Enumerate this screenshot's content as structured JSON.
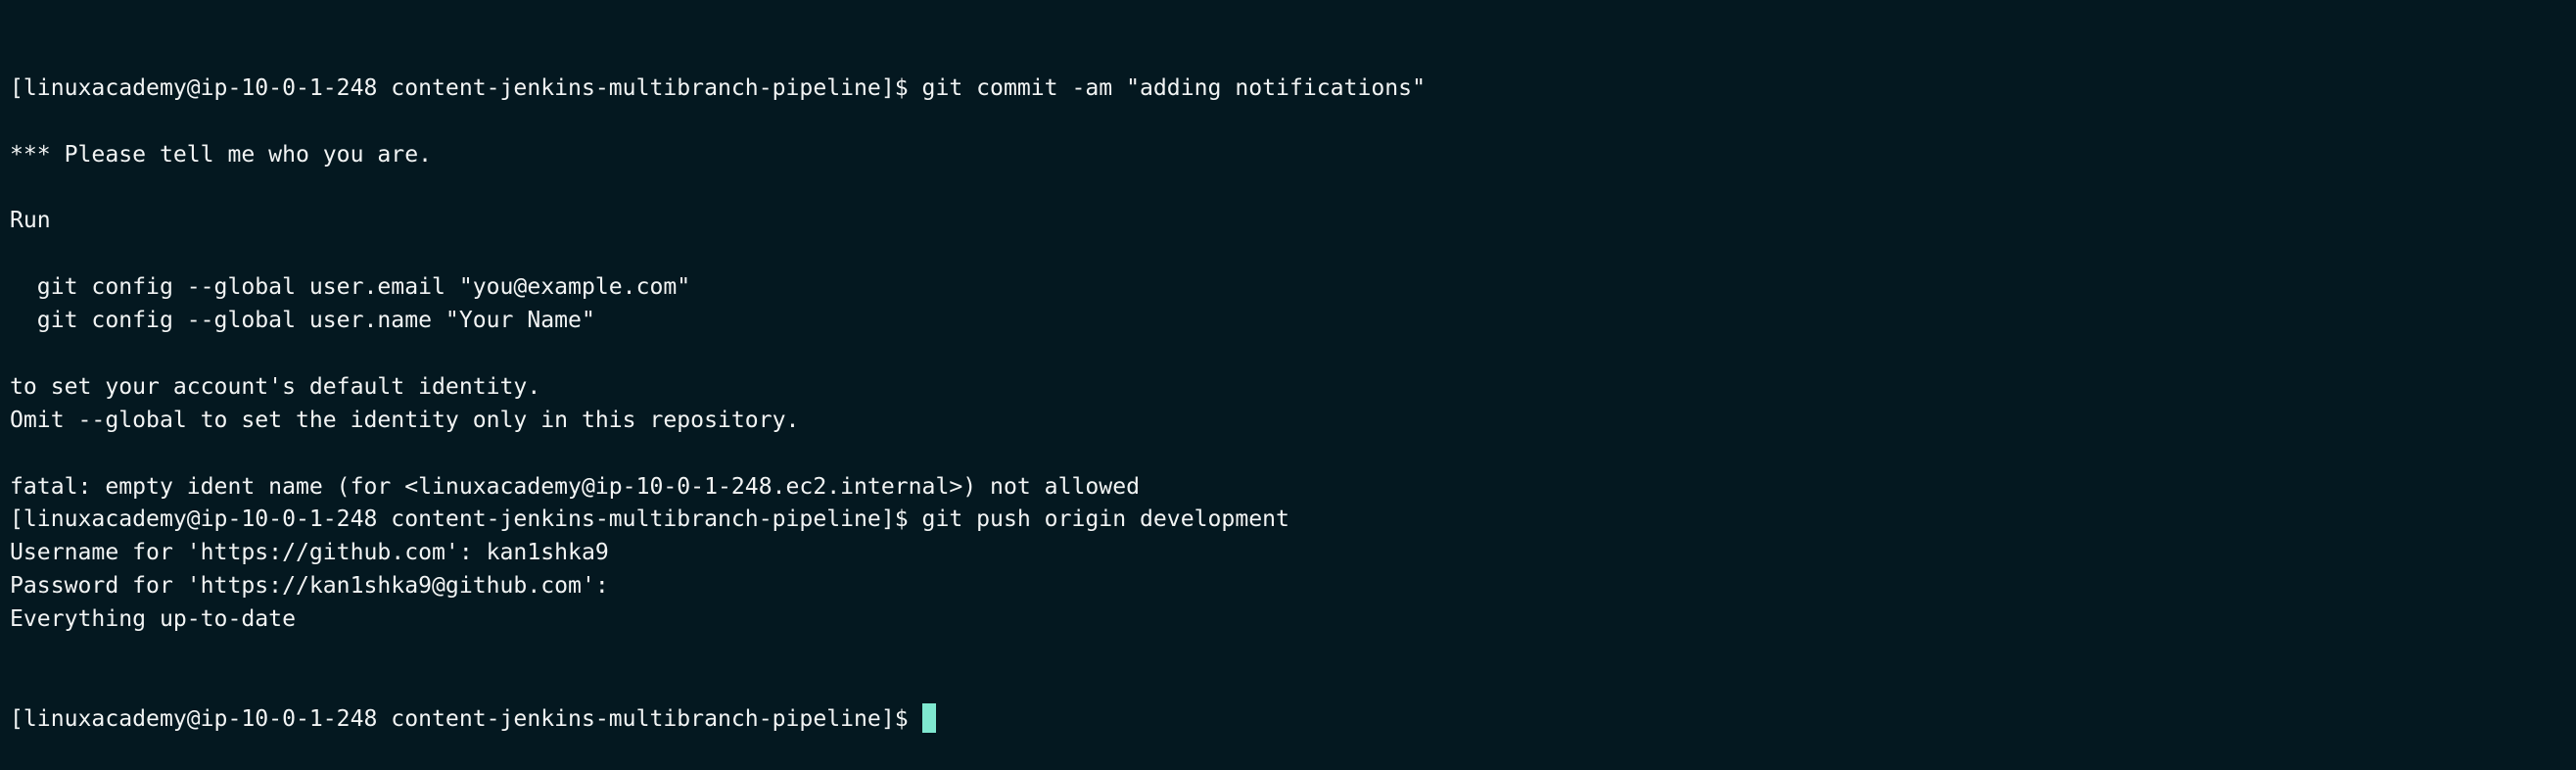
{
  "terminal": {
    "lines": [
      "[linuxacademy@ip-10-0-1-248 content-jenkins-multibranch-pipeline]$ git commit -am \"adding notifications\"",
      "",
      "*** Please tell me who you are.",
      "",
      "Run",
      "",
      "  git config --global user.email \"you@example.com\"",
      "  git config --global user.name \"Your Name\"",
      "",
      "to set your account's default identity.",
      "Omit --global to set the identity only in this repository.",
      "",
      "fatal: empty ident name (for <linuxacademy@ip-10-0-1-248.ec2.internal>) not allowed",
      "[linuxacademy@ip-10-0-1-248 content-jenkins-multibranch-pipeline]$ git push origin development",
      "Username for 'https://github.com': kan1shka9",
      "Password for 'https://kan1shka9@github.com':",
      "Everything up-to-date"
    ],
    "prompt": "[linuxacademy@ip-10-0-1-248 content-jenkins-multibranch-pipeline]$ ",
    "background_color": "#041820",
    "cursor_color": "#7fe8d0"
  }
}
